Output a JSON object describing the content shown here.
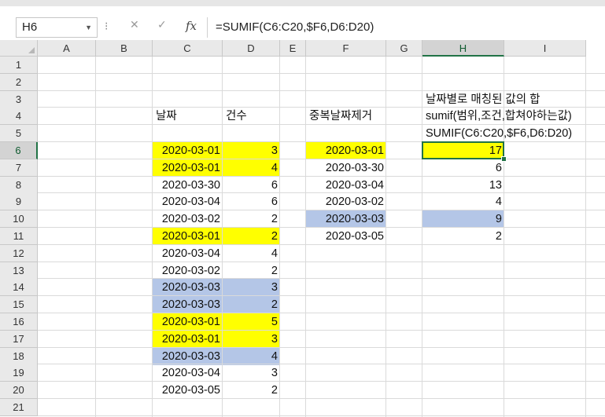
{
  "app": {
    "name_box": "H6",
    "formula": "=SUMIF(C6:C20,$F6,D6:D20)",
    "formula_buttons": {
      "cancel": "✕",
      "enter": "✓",
      "fx": "fx"
    },
    "menu_dots": "⁝"
  },
  "colors": {
    "yellow": "#ffff00",
    "blue": "#b4c6e7",
    "accent": "#217346"
  },
  "selected_cell": "H6",
  "columns": [
    "A",
    "B",
    "C",
    "D",
    "E",
    "F",
    "G",
    "H",
    "I"
  ],
  "rows": [
    "1",
    "2",
    "3",
    "4",
    "5",
    "6",
    "7",
    "8",
    "9",
    "10",
    "11",
    "12",
    "13",
    "14",
    "15",
    "16",
    "17",
    "18",
    "19",
    "20",
    "21"
  ],
  "cells": {
    "H3": "날짜별로 매칭된 값의 합",
    "C4": "날짜",
    "D4": "건수",
    "F4": "중복날짜제거",
    "H4": "sumif(범위,조건,합쳐야하는값)",
    "H5": "SUMIF(C6:C20,$F6,D6:D20)",
    "C6": "2020-03-01",
    "D6": "3",
    "F6": "2020-03-01",
    "H6": "17",
    "C7": "2020-03-01",
    "D7": "4",
    "F7": "2020-03-30",
    "H7": "6",
    "C8": "2020-03-30",
    "D8": "6",
    "F8": "2020-03-04",
    "H8": "13",
    "C9": "2020-03-04",
    "D9": "6",
    "F9": "2020-03-02",
    "H9": "4",
    "C10": "2020-03-02",
    "D10": "2",
    "F10": "2020-03-03",
    "H10": "9",
    "C11": "2020-03-01",
    "D11": "2",
    "F11": "2020-03-05",
    "H11": "2",
    "C12": "2020-03-04",
    "D12": "4",
    "C13": "2020-03-02",
    "D13": "2",
    "C14": "2020-03-03",
    "D14": "3",
    "C15": "2020-03-03",
    "D15": "2",
    "C16": "2020-03-01",
    "D16": "5",
    "C17": "2020-03-01",
    "D17": "3",
    "C18": "2020-03-03",
    "D18": "4",
    "C19": "2020-03-04",
    "D19": "3",
    "C20": "2020-03-05",
    "D20": "2"
  },
  "fills": {
    "yellow": [
      "C6",
      "D6",
      "C7",
      "D7",
      "C11",
      "D11",
      "C16",
      "D16",
      "C17",
      "D17",
      "F6",
      "H6"
    ],
    "blue": [
      "C14",
      "D14",
      "C15",
      "D15",
      "C18",
      "D18",
      "F10",
      "H10"
    ]
  }
}
